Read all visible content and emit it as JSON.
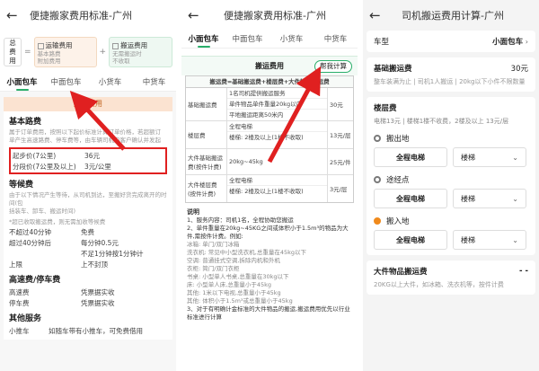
{
  "panel1": {
    "title": "便捷搬家费用标准-广州",
    "formula": {
      "total": "总费用",
      "equals": "=",
      "plus": "+",
      "card1_title": "运输费用",
      "card1_sub1": "基本路费",
      "card1_sub2": "附加费用",
      "card2_title": "搬运费用",
      "card2_sub1": "无需搬运时",
      "card2_sub2": "不收取"
    },
    "tabs": [
      "小面包车",
      "中面包车",
      "小货车",
      "中货车"
    ],
    "banner": "运输费用",
    "base": {
      "head": "基本路费",
      "desc1": "属于订单费用，按照以下起价标准计算订单价格，若超额订",
      "desc2": "单产生高速路费、停车费等，由车辆司机向客户确认并发起",
      "rows": [
        {
          "k": "起步价(7公里)",
          "v": "36元"
        },
        {
          "k": "分段价(7公里及以上)",
          "v": "3元/公里"
        }
      ]
    },
    "wait": {
      "head": "等候费",
      "desc1": "由于以下情况产生等待，从司机到达，至搬好货完成离开的时间(包",
      "desc2": "括装车、卸车、搬运时间)",
      "note": "*超已收取搬运费，则无需加收等候费",
      "rows": [
        {
          "k": "不超过40分钟",
          "v": "免费"
        },
        {
          "k": "超过40分钟后",
          "v": "每分钟0.5元"
        },
        {
          "k": "",
          "v": "不足1分钟按1分钟计"
        },
        {
          "k": "上限",
          "v": "上不封顶"
        }
      ]
    },
    "toll": {
      "head": "高速费/停车费",
      "rows": [
        {
          "k": "高速费",
          "v": "凭票据实收"
        },
        {
          "k": "停车费",
          "v": "凭票据实收"
        }
      ]
    },
    "other": {
      "head": "其他服务",
      "rows": [
        {
          "k": "小推车",
          "v": "如随车带有小推车，可免费借用"
        }
      ]
    }
  },
  "panel2": {
    "title": "便捷搬家费用标准-广州",
    "tabs": [
      "小面包车",
      "中面包车",
      "小货车",
      "中货车"
    ],
    "calc_title": "搬运费用",
    "calc_button": "帮我计算",
    "formula_row": "搬运费=基础搬运费+楼层费+大件物品搬运费",
    "table": [
      {
        "name": "基础搬运费",
        "subs": [
          "1名司机提供搬运服务",
          "单件物品单件重量20kg以内",
          "平地搬运距离50米内"
        ],
        "price": "30元"
      },
      {
        "name": "楼层费",
        "subs": [
          "全程电梯",
          "楼梯: 2楼及以上(1楼不收取)"
        ],
        "price": "13元/层"
      },
      {
        "name": "大件基础搬运费(按件计费)",
        "subs": [
          "20kg~45kg"
        ],
        "price": "25元/件"
      },
      {
        "name": "大件楼层费(按件计费)",
        "subs": [
          "全程电梯",
          "楼梯: 2楼及以上(1楼不收取)"
        ],
        "price": "3元/层"
      }
    ],
    "note_head": "说明",
    "notes": [
      "1、服务内容：司机1名，全程协助您搬运",
      "2、单件重量在20kg~45KG之间或体积小于1.5m³的物品为大件,需按件计费。例如:",
      "冰箱: 单门/双门冰箱",
      "洗衣机: 常见中小型洗衣机,总重量在45kg以下",
      "空调: 普通挂式空调,拆除内机和外机",
      "衣柜: 简门/双门衣柜",
      "书桌: 小型单人书桌,总重量在30kg以下",
      "床: 小型单人床,总重量小于45kg",
      "其他: 1米以下电视,总重量小于45kg",
      "其他: 体积小于1.5m³或总重量小于45kg",
      "3、对于有明确计金标准的大件物品的搬运,搬运费用优先以行业标准进行计算"
    ]
  },
  "panel3": {
    "title": "司机搬运费用计算-广州",
    "vehicle_label": "车型",
    "vehicle_value": "小面包车",
    "base_label": "基础搬运费",
    "base_value": "30元",
    "base_desc": "整车装满为止 | 司机1人搬运 | 20kg以下小件不限数量",
    "floor_label": "楼层费",
    "floor_desc": "电梯13元 | 楼梯1楼不收费，2楼及以上 13元/层",
    "stops": [
      {
        "name": "搬出地",
        "a": "全程电梯",
        "b": "楼梯"
      },
      {
        "name": "途经点",
        "a": "全程电梯",
        "b": "楼梯"
      },
      {
        "name": "搬入地",
        "a": "全程电梯",
        "b": "楼梯"
      }
    ],
    "big_label": "大件物品搬运费",
    "big_value": "- -",
    "big_desc": "20KG以上大件，如冰箱、洗衣机等，按件计费"
  }
}
